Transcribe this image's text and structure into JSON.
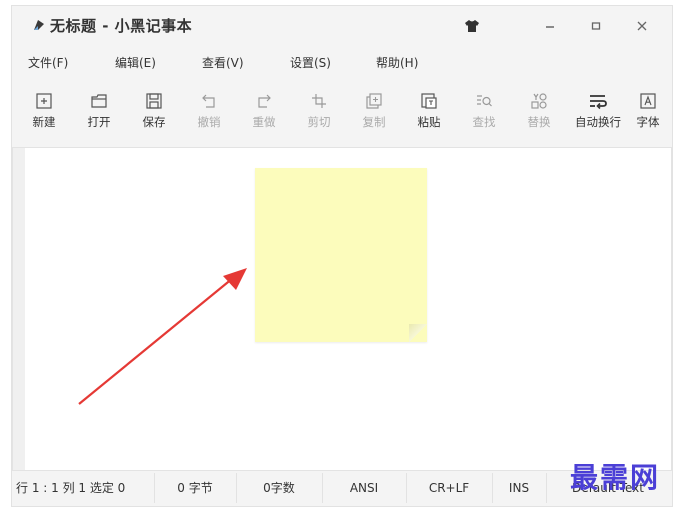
{
  "window": {
    "title": "无标题 - 小黑记事本"
  },
  "menu": [
    "文件(F)",
    "编辑(E)",
    "查看(V)",
    "设置(S)",
    "帮助(H)"
  ],
  "toolbar": [
    {
      "label": "新建",
      "icon": "new-doc-icon",
      "enabled": true
    },
    {
      "label": "打开",
      "icon": "folder-open-icon",
      "enabled": true
    },
    {
      "label": "保存",
      "icon": "save-icon",
      "enabled": true
    },
    {
      "label": "撤销",
      "icon": "undo-icon",
      "enabled": false
    },
    {
      "label": "重做",
      "icon": "redo-icon",
      "enabled": false
    },
    {
      "label": "剪切",
      "icon": "cut-icon",
      "enabled": false
    },
    {
      "label": "复制",
      "icon": "copy-icon",
      "enabled": false
    },
    {
      "label": "粘贴",
      "icon": "paste-icon",
      "enabled": true
    },
    {
      "label": "查找",
      "icon": "find-icon",
      "enabled": false
    },
    {
      "label": "替换",
      "icon": "replace-icon",
      "enabled": false
    },
    {
      "label": "自动换行",
      "icon": "word-wrap-icon",
      "enabled": true
    },
    {
      "label": "字体",
      "icon": "font-icon",
      "enabled": true
    }
  ],
  "status": {
    "position": "行 1 : 1  列 1  选定 0",
    "bytes": "0 字节",
    "chars": "0字数",
    "encoding": "ANSI",
    "line_ending": "CR+LF",
    "mode": "INS",
    "theme": "Default Text"
  },
  "watermark": "最需网",
  "colors": {
    "note": "#fcfcbc",
    "arrow": "#e53935",
    "watermark": "#4b3fd6"
  }
}
